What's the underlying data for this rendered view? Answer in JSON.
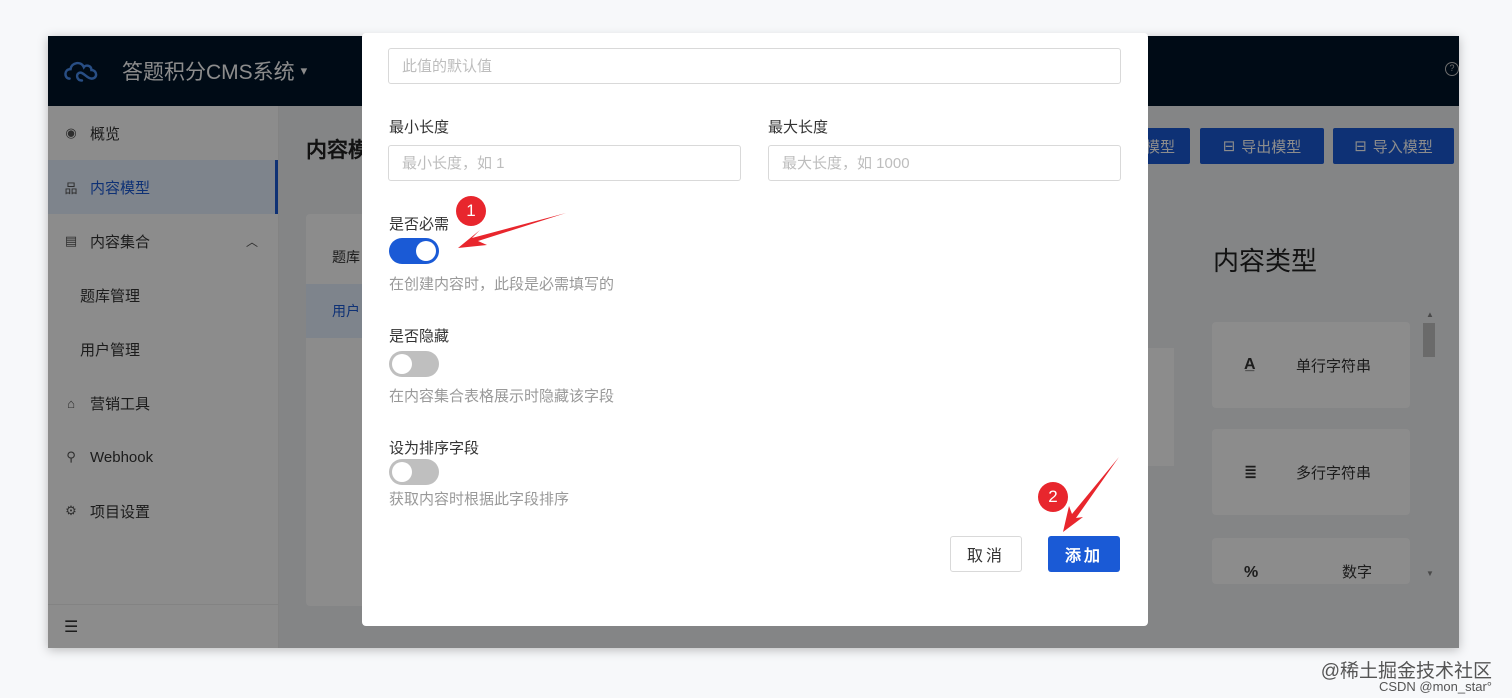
{
  "header": {
    "app_title": "答题积分CMS系统",
    "caret": "▾",
    "help": "?"
  },
  "sidebar": {
    "items": [
      {
        "label": "概览",
        "icon": "eye-icon",
        "glyph": "◉"
      },
      {
        "label": "内容模型",
        "icon": "model-icon",
        "glyph": "品"
      },
      {
        "label": "内容集合",
        "icon": "collection-icon",
        "glyph": "▤",
        "chevron": "︿"
      },
      {
        "label": "题库管理"
      },
      {
        "label": "用户管理"
      },
      {
        "label": "营销工具",
        "icon": "gift-icon",
        "glyph": "⌂"
      },
      {
        "label": "Webhook",
        "icon": "webhook-icon",
        "glyph": "⚲"
      },
      {
        "label": "项目设置",
        "icon": "gear-icon",
        "glyph": "⚙"
      }
    ],
    "collapse_glyph": "☰"
  },
  "content": {
    "title": "内容模",
    "left_rows": [
      "题库",
      "用户"
    ],
    "toolbar": {
      "create_label": "模型",
      "export_label": "导出模型",
      "import_label": "导入模型"
    },
    "types_title": "内容类型",
    "types": [
      {
        "glyph": "A̲",
        "label": "单行字符串"
      },
      {
        "glyph": "≣",
        "label": "多行字符串"
      },
      {
        "glyph": "%",
        "label": "数字"
      }
    ]
  },
  "modal": {
    "default_value_placeholder": "此值的默认值",
    "min_length_label": "最小长度",
    "min_length_placeholder": "最小长度，如 1",
    "max_length_label": "最大长度",
    "max_length_placeholder": "最大长度，如 1000",
    "required_label": "是否必需",
    "required_hint": "在创建内容时，此段是必需填写的",
    "required_on": true,
    "hidden_label": "是否隐藏",
    "hidden_hint": "在内容集合表格展示时隐藏该字段",
    "hidden_on": false,
    "sort_label": "设为排序字段",
    "sort_hint": "获取内容时根据此字段排序",
    "sort_on": false,
    "cancel_label": "取消",
    "add_label": "添加"
  },
  "annotations": {
    "badge1": "1",
    "badge2": "2"
  },
  "colors": {
    "primary": "#1a5ad6",
    "header_bg": "#001529",
    "badge": "#e8262d"
  },
  "watermark": {
    "line1": "@稀土掘金技术社区",
    "line2": "CSDN @mon_star°"
  }
}
